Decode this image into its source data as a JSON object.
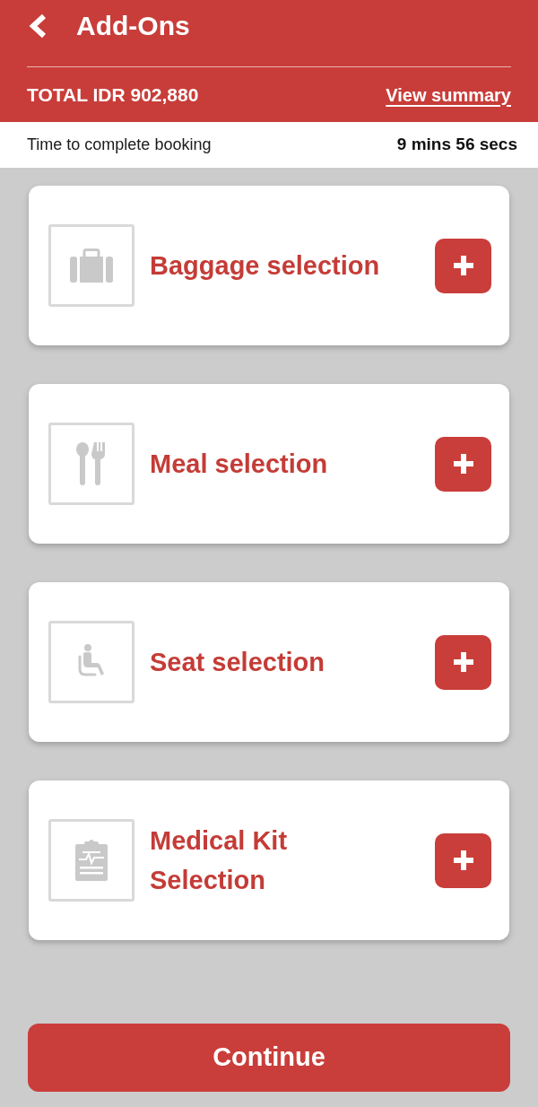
{
  "header": {
    "title": "Add-Ons",
    "total": "TOTAL IDR 902,880",
    "summary_link": "View summary"
  },
  "timer": {
    "label": "Time to complete booking",
    "value": "9 mins 56 secs"
  },
  "addons": [
    {
      "kind": "baggage",
      "title": "Baggage selection"
    },
    {
      "kind": "meal",
      "title": "Meal selection"
    },
    {
      "kind": "seat",
      "title": "Seat selection"
    },
    {
      "kind": "medical",
      "title": "Medical Kit Selection"
    }
  ],
  "continue_button": "Continue"
}
